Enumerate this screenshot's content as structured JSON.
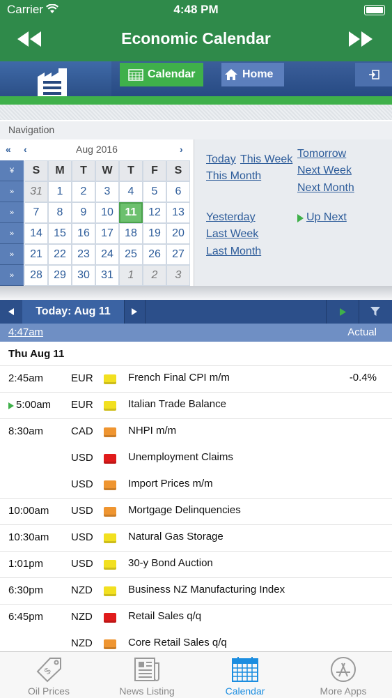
{
  "status": {
    "carrier": "Carrier",
    "time": "4:48 PM"
  },
  "header": {
    "title": "Economic Calendar"
  },
  "tabs": {
    "calendar": "Calendar",
    "home": "Home"
  },
  "navigation_label": "Navigation",
  "calendar": {
    "month_label": "Aug 2016",
    "weekdays": [
      "S",
      "M",
      "T",
      "W",
      "T",
      "F",
      "S"
    ],
    "weeks": [
      [
        "31",
        "1",
        "2",
        "3",
        "4",
        "5",
        "6"
      ],
      [
        "7",
        "8",
        "9",
        "10",
        "11",
        "12",
        "13"
      ],
      [
        "14",
        "15",
        "16",
        "17",
        "18",
        "19",
        "20"
      ],
      [
        "21",
        "22",
        "23",
        "24",
        "25",
        "26",
        "27"
      ],
      [
        "28",
        "29",
        "30",
        "31",
        "1",
        "2",
        "3"
      ]
    ]
  },
  "quick_links": {
    "today": "Today",
    "this_week": "This Week",
    "tomorrow": "Tomorrow",
    "this_month": "This Month",
    "next_week": "Next Week",
    "next_month": "Next Month",
    "yesterday": "Yesterday",
    "up_next": "Up Next",
    "last_week": "Last Week",
    "last_month": "Last Month"
  },
  "day_bar": {
    "label": "Today: Aug 11"
  },
  "timeline": {
    "current_time": "4:47am",
    "actual_header": "Actual"
  },
  "events": {
    "date_header": "Thu Aug 11",
    "rows": [
      {
        "time": "2:45am",
        "currency": "EUR",
        "impact": "#f2e020",
        "name": "French Final CPI m/m",
        "actual": "-0.4%"
      },
      {
        "time": "5:00am",
        "currency": "EUR",
        "impact": "#f2e020",
        "name": "Italian Trade Balance",
        "actual": ""
      },
      {
        "time": "8:30am",
        "currency": "CAD",
        "impact": "#ef9530",
        "name": "NHPI m/m",
        "actual": ""
      },
      {
        "time": "",
        "currency": "USD",
        "impact": "#e01b1b",
        "name": "Unemployment Claims",
        "actual": ""
      },
      {
        "time": "",
        "currency": "USD",
        "impact": "#ef9530",
        "name": "Import Prices m/m",
        "actual": ""
      },
      {
        "time": "10:00am",
        "currency": "USD",
        "impact": "#ef9530",
        "name": "Mortgage Delinquencies",
        "actual": ""
      },
      {
        "time": "10:30am",
        "currency": "USD",
        "impact": "#f2e020",
        "name": "Natural Gas Storage",
        "actual": ""
      },
      {
        "time": "1:01pm",
        "currency": "USD",
        "impact": "#f2e020",
        "name": "30-y Bond Auction",
        "actual": ""
      },
      {
        "time": "6:30pm",
        "currency": "NZD",
        "impact": "#f2e020",
        "name": "Business NZ Manufacturing Index",
        "actual": ""
      },
      {
        "time": "6:45pm",
        "currency": "NZD",
        "impact": "#e01b1b",
        "name": "Retail Sales q/q",
        "actual": ""
      },
      {
        "time": "",
        "currency": "NZD",
        "impact": "#ef9530",
        "name": "Core Retail Sales q/q",
        "actual": ""
      }
    ]
  },
  "bottom_tabs": {
    "oil": "Oil Prices",
    "news": "News Listing",
    "calendar": "Calendar",
    "more": "More Apps"
  },
  "colors": {
    "brand_green": "#2f8a4a",
    "nav_blue": "#2c4f8a",
    "active_blue": "#1b8de0"
  }
}
